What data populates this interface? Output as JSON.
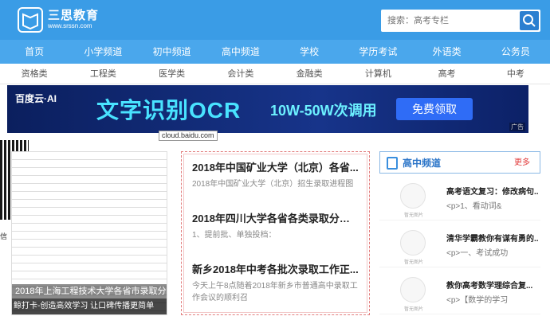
{
  "logo": {
    "cn": "三思教育",
    "en": "www.srssn.com"
  },
  "search": {
    "placeholder": "搜索：高考专栏"
  },
  "nav_main": [
    "首页",
    "小学频道",
    "初中频道",
    "高中频道",
    "学校",
    "学历考试",
    "外语类",
    "公务员"
  ],
  "nav_sub": [
    "资格类",
    "工程类",
    "医学类",
    "会计类",
    "金融类",
    "计算机",
    "高考",
    "中考"
  ],
  "banner": {
    "brand": "百度云·AI",
    "title": "文字识别OCR",
    "subtitle": "10W-50W次调用",
    "button": "免费领取",
    "ad_tag": "广告"
  },
  "tooltip": "cloud.baidu.com",
  "left": {
    "qr_label": "信",
    "slide_caption": "2018年上海工程技术大学各省市录取分",
    "slide_bar": "鲸打卡-创造高效学习 让口碑传播更简单"
  },
  "articles": [
    {
      "title": "2018年中国矿业大学（北京）各省...",
      "summary": "2018年中国矿业大学（北京）招生录取进程图"
    },
    {
      "title": "2018年四川大学各省各类录取分数线",
      "summary": "1、提前批、单独投档："
    },
    {
      "title": "新乡2018年中考各批次录取工作正...",
      "summary": "今天上午8点随着2018年新乡市普通高中录取工作会议的顺利召"
    }
  ],
  "right": {
    "header": "高中频道",
    "more": "更多",
    "thumb_label": "暂无图片",
    "items": [
      {
        "title": "高考语文复习：修改病句...",
        "desc": "<p>1、看动词&"
      },
      {
        "title": "清华学霸教你有谋有勇的...",
        "desc": "<p>一、考试成功"
      },
      {
        "title": "教你高考数学理综合复...",
        "desc": "<p>【数学的学习"
      }
    ]
  }
}
